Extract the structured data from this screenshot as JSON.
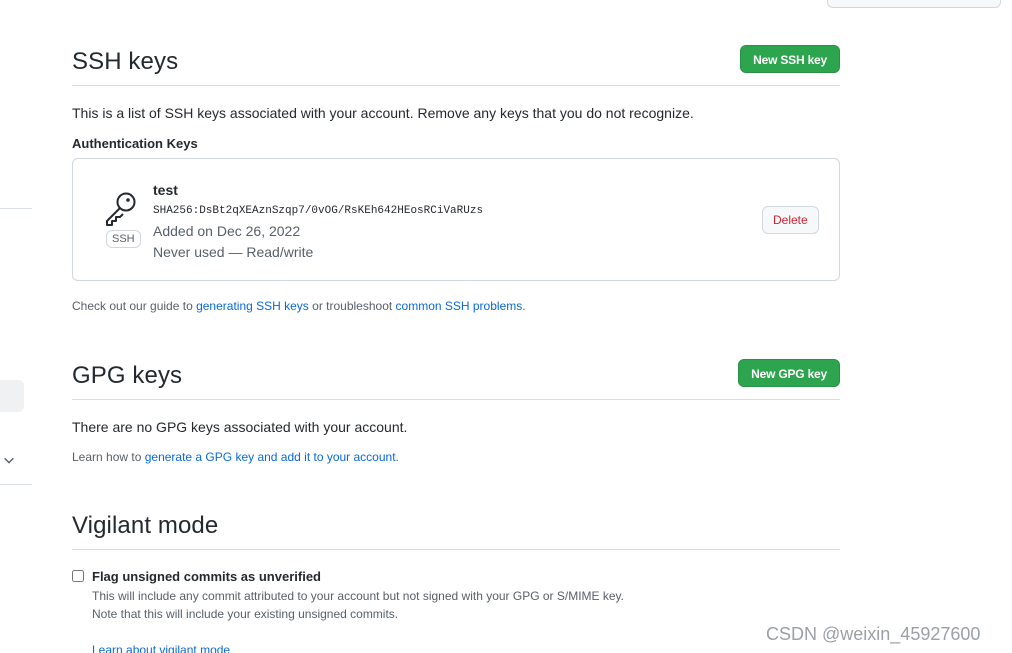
{
  "ssh": {
    "title": "SSH keys",
    "new_button": "New SSH key",
    "description": "This is a list of SSH keys associated with your account. Remove any keys that you do not recognize.",
    "subheading": "Authentication Keys",
    "keys": [
      {
        "title": "test",
        "badge": "SSH",
        "fingerprint": "SHA256:DsBt2qXEAznSzqp7/0vOG/RsKEh642HEosRCiVaRUzs",
        "added": "Added on Dec 26, 2022",
        "usage": "Never used — Read/write",
        "delete_label": "Delete",
        "icon": "key-icon"
      }
    ],
    "guide_prefix": "Check out our guide to ",
    "guide_link": "generating SSH keys",
    "guide_middle": " or troubleshoot ",
    "guide_link2": "common SSH problems",
    "guide_suffix": "."
  },
  "gpg": {
    "title": "GPG keys",
    "new_button": "New GPG key",
    "empty_text": "There are no GPG keys associated with your account.",
    "learn_prefix": "Learn how to ",
    "learn_link": "generate a GPG key and add it to your account",
    "learn_suffix": "."
  },
  "vigilant": {
    "title": "Vigilant mode",
    "checkbox_label": "Flag unsigned commits as unverified",
    "checked": false,
    "note_line1": "This will include any commit attributed to your account but not signed with your GPG or S/MIME key.",
    "note_line2": "Note that this will include your existing unsigned commits.",
    "learn_link": "Learn about vigilant mode"
  },
  "watermark": "CSDN @weixin_45927600",
  "colors": {
    "accent_green": "#2da44e",
    "link_blue": "#0969da",
    "danger_red": "#cf222e"
  }
}
